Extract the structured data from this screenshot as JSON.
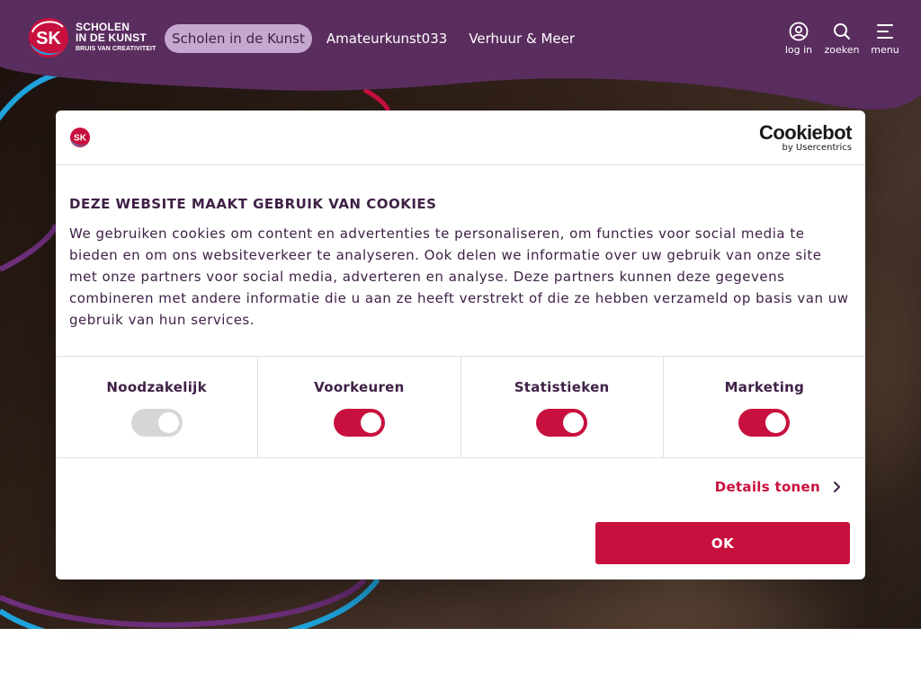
{
  "colors": {
    "brand_purple": "#5a2d5f",
    "accent_red": "#c8103e",
    "nav_active_bg": "#c6a7cf"
  },
  "logo": {
    "line1": "SCHOLEN",
    "line2": "IN DE KUNST",
    "line3": "BRUIS VAN CREATIVITEIT",
    "mark": "SK"
  },
  "nav": {
    "items": [
      {
        "label": "Scholen in de Kunst",
        "active": true
      },
      {
        "label": "Amateurkunst033",
        "active": false
      },
      {
        "label": "Verhuur & Meer",
        "active": false
      }
    ]
  },
  "tools": {
    "login": {
      "label": "log in",
      "icon": "user-circle-icon"
    },
    "search": {
      "label": "zoeken",
      "icon": "search-icon"
    },
    "menu": {
      "label": "menu",
      "icon": "menu-icon"
    }
  },
  "cookie_dialog": {
    "brand": {
      "name": "Cookiebot",
      "by": "by Usercentrics"
    },
    "title": "DEZE WEBSITE MAAKT GEBRUIK VAN COOKIES",
    "text": "We gebruiken cookies om content en advertenties te personaliseren, om functies voor social media te bieden en om ons websiteverkeer te analyseren. Ook delen we informatie over uw gebruik van onze site met onze partners voor social media, adverteren en analyse. Deze partners kunnen deze gegevens combineren met andere informatie die u aan ze heeft verstrekt of die ze hebben verzameld op basis van uw gebruik van hun services.",
    "categories": [
      {
        "label": "Noodzakelijk",
        "enabled": true,
        "disabled": true
      },
      {
        "label": "Voorkeuren",
        "enabled": true,
        "disabled": false
      },
      {
        "label": "Statistieken",
        "enabled": true,
        "disabled": false
      },
      {
        "label": "Marketing",
        "enabled": true,
        "disabled": false
      }
    ],
    "details_label": "Details tonen",
    "ok_label": "OK"
  }
}
